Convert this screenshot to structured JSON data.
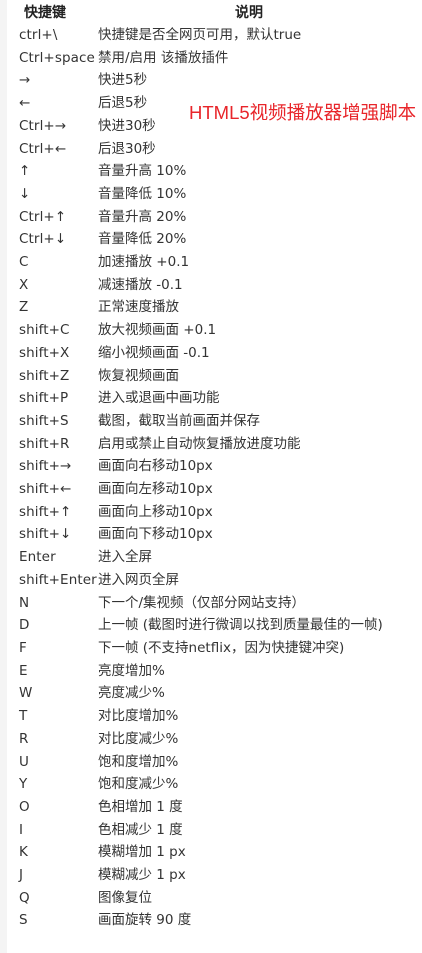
{
  "header": {
    "key_label": "快捷键",
    "desc_label": "说明"
  },
  "overlay": {
    "title": "HTML5视频播放器增强脚本",
    "color": "#e8252a"
  },
  "rows": [
    {
      "key": "ctrl+\\",
      "desc": "快捷键是否全网页可用，默认true"
    },
    {
      "key": "Ctrl+space",
      "desc": "禁用/启用 该播放插件"
    },
    {
      "key": "→",
      "desc": "快进5秒"
    },
    {
      "key": "←",
      "desc": "后退5秒"
    },
    {
      "key": "Ctrl+→",
      "desc": "快进30秒"
    },
    {
      "key": "Ctrl+←",
      "desc": "后退30秒"
    },
    {
      "key": "↑",
      "desc": "音量升高 10%"
    },
    {
      "key": "↓",
      "desc": "音量降低 10%"
    },
    {
      "key": "Ctrl+↑",
      "desc": "音量升高 20%"
    },
    {
      "key": "Ctrl+↓",
      "desc": "音量降低 20%"
    },
    {
      "key": "C",
      "desc": "加速播放 +0.1"
    },
    {
      "key": "X",
      "desc": "减速播放 -0.1"
    },
    {
      "key": "Z",
      "desc": "正常速度播放"
    },
    {
      "key": "shift+C",
      "desc": "放大视频画面 +0.1"
    },
    {
      "key": "shift+X",
      "desc": "缩小视频画面 -0.1"
    },
    {
      "key": "shift+Z",
      "desc": "恢复视频画面"
    },
    {
      "key": "shift+P",
      "desc": "进入或退画中画功能"
    },
    {
      "key": "shift+S",
      "desc": "截图，截取当前画面并保存"
    },
    {
      "key": "shift+R",
      "desc": "启用或禁止自动恢复播放进度功能"
    },
    {
      "key": "shift+→",
      "desc": "画面向右移动10px"
    },
    {
      "key": "shift+←",
      "desc": "画面向左移动10px"
    },
    {
      "key": "shift+↑",
      "desc": "画面向上移动10px"
    },
    {
      "key": "shift+↓",
      "desc": "画面向下移动10px"
    },
    {
      "key": "Enter",
      "desc": "进入全屏"
    },
    {
      "key": "shift+Enter",
      "desc": "进入网页全屏"
    },
    {
      "key": "N",
      "desc": "下一个/集视频（仅部分网站支持）"
    },
    {
      "key": "D",
      "desc": "上一帧 (截图时进行微调以找到质量最佳的一帧)"
    },
    {
      "key": "F",
      "desc": "下一帧 (不支持netflix，因为快捷键冲突)"
    },
    {
      "key": "E",
      "desc": "亮度增加%"
    },
    {
      "key": "W",
      "desc": "亮度减少%"
    },
    {
      "key": "T",
      "desc": "对比度增加%"
    },
    {
      "key": "R",
      "desc": "对比度减少%"
    },
    {
      "key": "U",
      "desc": "饱和度增加%"
    },
    {
      "key": "Y",
      "desc": "饱和度减少%"
    },
    {
      "key": "O",
      "desc": "色相增加 1 度"
    },
    {
      "key": "I",
      "desc": "色相减少 1 度"
    },
    {
      "key": "K",
      "desc": "模糊增加 1 px"
    },
    {
      "key": "J",
      "desc": "模糊减少 1 px"
    },
    {
      "key": "Q",
      "desc": "图像复位"
    },
    {
      "key": "S",
      "desc": "画面旋转 90 度"
    }
  ]
}
